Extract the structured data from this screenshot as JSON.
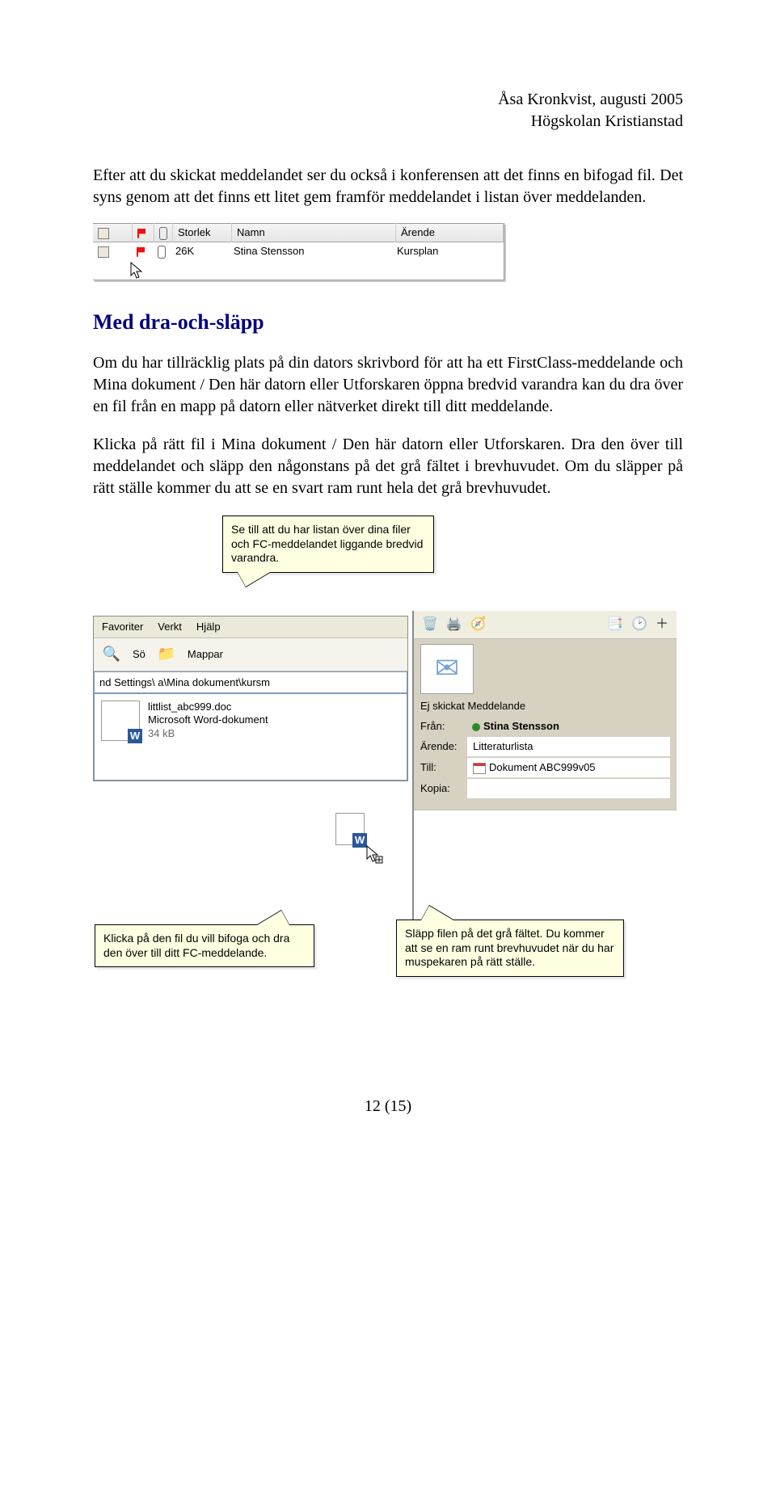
{
  "header": {
    "author_line": "Åsa Kronkvist, augusti 2005",
    "org_line": "Högskolan Kristianstad"
  },
  "paragraphs": {
    "p1": "Efter att du skickat meddelandet ser du också i konferensen att det finns en bifogad fil. Det syns genom att det finns ett litet gem framför meddelandet i listan över meddelanden."
  },
  "shot1": {
    "headers": {
      "storlek": "Storlek",
      "namn": "Namn",
      "arende": "Ärende"
    },
    "row": {
      "size": "26K",
      "name": "Stina Stensson",
      "subject": "Kursplan"
    }
  },
  "section": {
    "title": "Med dra-och-släpp",
    "p2": "Om du har tillräcklig plats på din dators skrivbord för att ha ett FirstClass-meddelande och Mina dokument / Den här datorn eller Utforskaren öppna bredvid varandra kan du dra över en fil från en mapp på datorn eller nätverket direkt till ditt meddelande.",
    "p3": "Klicka på rätt fil i Mina dokument / Den här datorn eller Utforskaren. Dra den över till meddelandet och släpp den någonstans på det grå fältet i brevhuvudet. Om du släpper på rätt ställe kommer du att se en svart ram runt hela det grå brevhuvudet."
  },
  "shot2": {
    "callouts": {
      "top": "Se till att du har listan över dina filer och FC-meddelandet liggande bredvid varandra.",
      "bl": "Klicka på den fil du vill bifoga och dra den över till ditt FC-meddelande.",
      "br": "Släpp filen på det grå fältet. Du kommer att se en ram runt brevhuvudet när du har muspekaren på rätt ställe."
    },
    "explorer": {
      "menus": {
        "favoriter": "Favoriter",
        "verktyg": "Verkt",
        "hjalp": "Hjälp"
      },
      "toolbar": {
        "search": "Sö",
        "folders": "Mappar"
      },
      "address": "nd Settings\\ a\\Mina dokument\\kursm",
      "file": {
        "name": "littlist_abc999.doc",
        "type": "Microsoft Word-dokument",
        "size": "34 kB"
      }
    },
    "msgwin": {
      "status": "Ej skickat Meddelande",
      "labels": {
        "from": "Från:",
        "subject": "Ärende:",
        "to": "Till:",
        "cc": "Kopia:"
      },
      "values": {
        "from": "Stina Stensson",
        "subject": "Litteraturlista",
        "to": "Dokument ABC999v05",
        "cc": ""
      }
    }
  },
  "page_num": "12 (15)"
}
